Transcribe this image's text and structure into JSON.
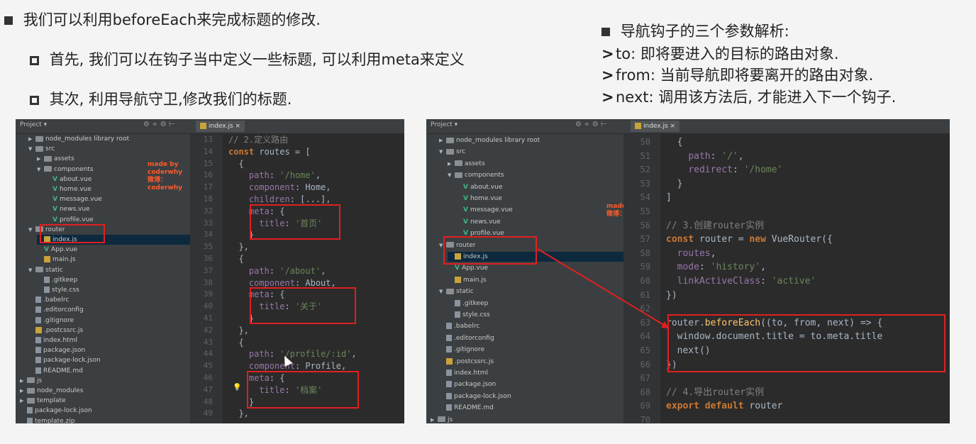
{
  "slide": {
    "heading": "我们可以利用beforeEach来完成标题的修改.",
    "sub1": "首先, 我们可以在钩子当中定义一些标题, 可以利用meta来定义",
    "sub2": "其次, 利用导航守卫,修改我们的标题.",
    "right_title": "导航钩子的三个参数解析:",
    "right_items": [
      "to: 即将要进入的目标的路由对象.",
      "from: 当前导航即将要离开的路由对象.",
      "next: 调用该方法后, 才能进入下一个钩子."
    ]
  },
  "ide_left": {
    "project_label": "Project ▾",
    "tab": "index.js",
    "watermark": [
      "made by coderwhy",
      "微博：coderwhy"
    ],
    "tree": [
      "node_modules  library root",
      "src",
      "assets",
      "components",
      "about.vue",
      "home.vue",
      "message.vue",
      "news.vue",
      "profile.vue",
      "router",
      "index.js",
      "App.vue",
      "main.js",
      "static",
      ".gitkeep",
      "style.css",
      ".babelrc",
      ".editorconfig",
      ".gitignore",
      ".postcssrc.js",
      "index.html",
      "package.json",
      "package-lock.json",
      "README.md",
      "js",
      "node_modules",
      "template",
      "package-lock.json",
      "template.zip"
    ],
    "line_numbers": [
      "13",
      "14",
      "15",
      "16",
      "17",
      "18",
      "32",
      "33",
      "34",
      "35",
      "36",
      "37",
      "38",
      "39",
      "40",
      "41",
      "42",
      "43",
      "44",
      "45",
      "46",
      "47",
      "48",
      "49"
    ],
    "code": [
      "// 2.定义路由",
      "const routes = [",
      "  {",
      "    path: '/home',",
      "    component: Home,",
      "    children: [...],",
      "    meta: {",
      "      title: '首页'",
      "    }",
      "  },",
      "  {",
      "    path: '/about',",
      "    component: About,",
      "    meta: {",
      "      title: '关于'",
      "    }",
      "  },",
      "  {",
      "    path: '/profile/:id',",
      "    component: Profile,",
      "    meta: {",
      "      title: '档案'",
      "    }",
      "  },"
    ]
  },
  "ide_right": {
    "project_label": "Project ▾",
    "tab": "index.js",
    "watermark": [
      "made by coderwhy",
      "微博：coderwhy"
    ],
    "tree": [
      "node_modules  library root",
      "src",
      "assets",
      "components",
      "about.vue",
      "home.vue",
      "message.vue",
      "news.vue",
      "profile.vue",
      "router",
      "index.js",
      "App.vue",
      "main.js",
      "static",
      ".gitkeep",
      "style.css",
      ".babelrc",
      ".editorconfig",
      ".gitignore",
      ".postcssrc.js",
      "index.html",
      "package.json",
      "package-lock.json",
      "README.md",
      "js"
    ],
    "line_numbers": [
      "50",
      "51",
      "52",
      "53",
      "54",
      "55",
      "56",
      "57",
      "58",
      "59",
      "60",
      "61",
      "62",
      "63",
      "64",
      "65",
      "66",
      "67",
      "68",
      "69",
      "70"
    ],
    "code": [
      "  {",
      "    path: '/',",
      "    redirect: '/home'",
      "  }",
      "]",
      "",
      "// 3.创建router实例",
      "const router = new VueRouter({",
      "  routes,",
      "  mode: 'history',",
      "  linkActiveClass: 'active'",
      "})",
      "",
      "router.beforeEach((to, from, next) => {",
      "  window.document.title = to.meta.title",
      "  next()",
      "})",
      "",
      "// 4.导出router实例",
      "export default router",
      ""
    ]
  },
  "colors": {
    "ide_bg": "#2b2b2b",
    "panel_bg": "#3c3f41",
    "highlight_red": "#e02020",
    "keyword": "#cc7832",
    "string": "#6a8759"
  }
}
